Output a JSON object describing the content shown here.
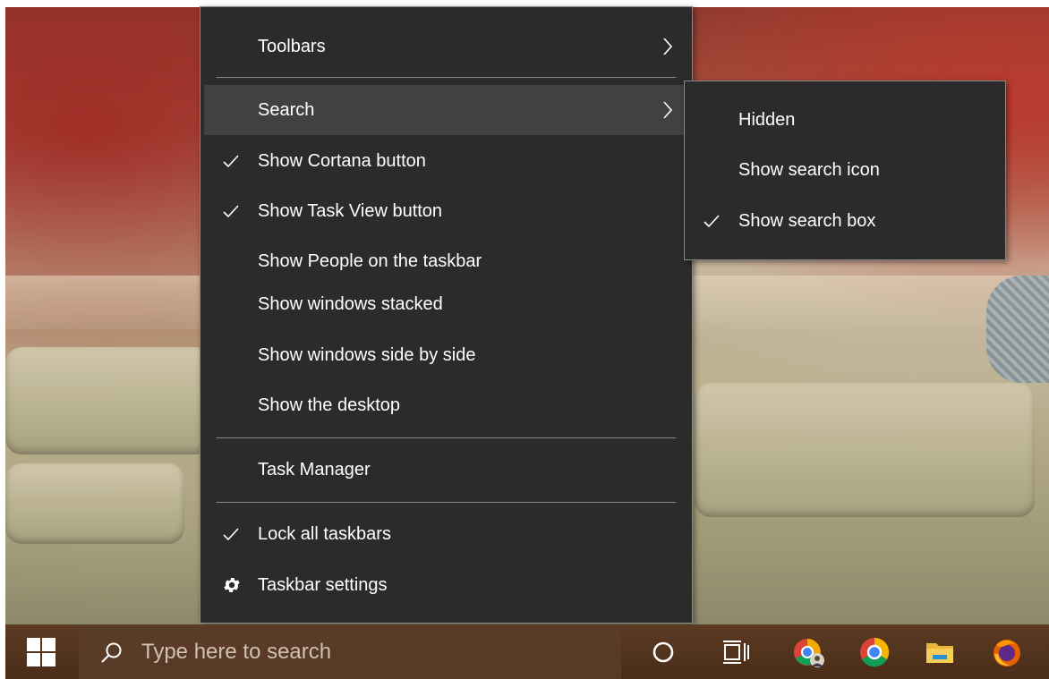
{
  "menu": {
    "toolbars": "Toolbars",
    "search": "Search",
    "show_cortana": "Show Cortana button",
    "show_task_view": "Show Task View button",
    "show_people": "Show People on the taskbar",
    "show_stacked": "Show windows stacked",
    "show_side_by_side": "Show windows side by side",
    "show_desktop": "Show the desktop",
    "task_manager": "Task Manager",
    "lock_taskbars": "Lock all taskbars",
    "taskbar_settings": "Taskbar settings"
  },
  "submenu": {
    "hidden": "Hidden",
    "show_search_icon": "Show search icon",
    "show_search_box": "Show search box"
  },
  "taskbar": {
    "search_placeholder": "Type here to search"
  },
  "colors": {
    "menu_bg": "#2b2b2b",
    "highlight": "#414141",
    "taskbar": "#4a2d18"
  }
}
